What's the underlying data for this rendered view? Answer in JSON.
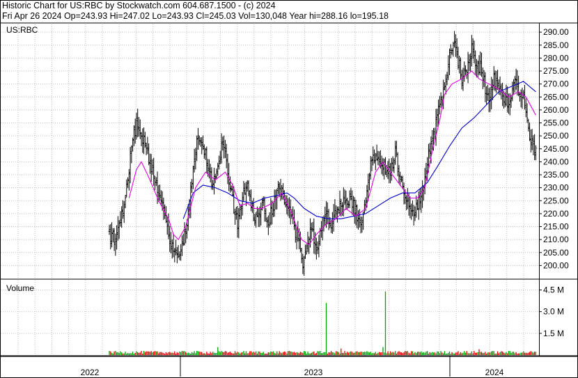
{
  "header": {
    "line1": "Historic Chart for US:RBC by Stockwatch.com 604.687.1500 - (c) 2024",
    "line2": "Fri Apr 26 2024   Op=243.93   Hi=247.02   Lo=243.93   Cl=245.03   Vol=130,048   Year hi=288.16   lo=195.18"
  },
  "chart_data": [
    {
      "type": "line",
      "panel": "price",
      "label": "US:RBC",
      "style": "OHLC bars with two moving averages",
      "ylim": [
        195,
        293
      ],
      "y_ticks": [
        "290.00",
        "285.00",
        "280.00",
        "275.00",
        "270.00",
        "265.00",
        "260.00",
        "255.00",
        "250.00",
        "245.00",
        "240.00",
        "235.00",
        "230.00",
        "225.00",
        "220.00",
        "215.00",
        "210.00",
        "205.00",
        "200.00"
      ],
      "x_ticks": [
        "2022",
        "2023",
        "2024"
      ],
      "grid": true,
      "colors": {
        "bars": "#000000",
        "ma_short": "#e000e0",
        "ma_long": "#0000cc"
      },
      "close_anchors": [
        {
          "i": 0,
          "c": 212
        },
        {
          "i": 5,
          "c": 210
        },
        {
          "i": 12,
          "c": 222
        },
        {
          "i": 18,
          "c": 245
        },
        {
          "i": 22,
          "c": 255
        },
        {
          "i": 28,
          "c": 248
        },
        {
          "i": 32,
          "c": 242
        },
        {
          "i": 38,
          "c": 232
        },
        {
          "i": 44,
          "c": 222
        },
        {
          "i": 48,
          "c": 210
        },
        {
          "i": 52,
          "c": 205
        },
        {
          "i": 58,
          "c": 206
        },
        {
          "i": 62,
          "c": 214
        },
        {
          "i": 66,
          "c": 228
        },
        {
          "i": 72,
          "c": 250
        },
        {
          "i": 76,
          "c": 247
        },
        {
          "i": 80,
          "c": 238
        },
        {
          "i": 84,
          "c": 232
        },
        {
          "i": 88,
          "c": 236
        },
        {
          "i": 92,
          "c": 248
        },
        {
          "i": 95,
          "c": 240
        },
        {
          "i": 100,
          "c": 225
        },
        {
          "i": 104,
          "c": 215
        },
        {
          "i": 108,
          "c": 225
        },
        {
          "i": 112,
          "c": 232
        },
        {
          "i": 116,
          "c": 222
        },
        {
          "i": 120,
          "c": 217
        },
        {
          "i": 124,
          "c": 225
        },
        {
          "i": 128,
          "c": 215
        },
        {
          "i": 132,
          "c": 222
        },
        {
          "i": 138,
          "c": 230
        },
        {
          "i": 142,
          "c": 226
        },
        {
          "i": 146,
          "c": 220
        },
        {
          "i": 150,
          "c": 215
        },
        {
          "i": 154,
          "c": 208
        },
        {
          "i": 157,
          "c": 200
        },
        {
          "i": 160,
          "c": 206
        },
        {
          "i": 164,
          "c": 214
        },
        {
          "i": 168,
          "c": 208
        },
        {
          "i": 172,
          "c": 212
        },
        {
          "i": 176,
          "c": 220
        },
        {
          "i": 180,
          "c": 215
        },
        {
          "i": 184,
          "c": 222
        },
        {
          "i": 188,
          "c": 224
        },
        {
          "i": 192,
          "c": 226
        },
        {
          "i": 196,
          "c": 225
        },
        {
          "i": 200,
          "c": 221
        },
        {
          "i": 204,
          "c": 216
        },
        {
          "i": 208,
          "c": 226
        },
        {
          "i": 212,
          "c": 238
        },
        {
          "i": 216,
          "c": 244
        },
        {
          "i": 220,
          "c": 240
        },
        {
          "i": 224,
          "c": 238
        },
        {
          "i": 228,
          "c": 236
        },
        {
          "i": 232,
          "c": 244
        },
        {
          "i": 236,
          "c": 233
        },
        {
          "i": 240,
          "c": 228
        },
        {
          "i": 244,
          "c": 224
        },
        {
          "i": 248,
          "c": 220
        },
        {
          "i": 252,
          "c": 226
        },
        {
          "i": 256,
          "c": 232
        },
        {
          "i": 260,
          "c": 245
        },
        {
          "i": 264,
          "c": 252
        },
        {
          "i": 268,
          "c": 262
        },
        {
          "i": 272,
          "c": 268
        },
        {
          "i": 276,
          "c": 280
        },
        {
          "i": 280,
          "c": 288
        },
        {
          "i": 283,
          "c": 279
        },
        {
          "i": 286,
          "c": 272
        },
        {
          "i": 290,
          "c": 276
        },
        {
          "i": 294,
          "c": 284
        },
        {
          "i": 298,
          "c": 278
        },
        {
          "i": 302,
          "c": 276
        },
        {
          "i": 305,
          "c": 268
        },
        {
          "i": 308,
          "c": 262
        },
        {
          "i": 312,
          "c": 272
        },
        {
          "i": 316,
          "c": 268
        },
        {
          "i": 320,
          "c": 264
        },
        {
          "i": 324,
          "c": 262
        },
        {
          "i": 328,
          "c": 270
        },
        {
          "i": 332,
          "c": 268
        },
        {
          "i": 336,
          "c": 264
        },
        {
          "i": 340,
          "c": 253
        },
        {
          "i": 344,
          "c": 246
        },
        {
          "i": 346,
          "c": 245
        }
      ],
      "ma_short_anchors": [
        {
          "i": 16,
          "v": 226
        },
        {
          "i": 22,
          "v": 237
        },
        {
          "i": 26,
          "v": 240
        },
        {
          "i": 32,
          "v": 234
        },
        {
          "i": 40,
          "v": 225
        },
        {
          "i": 48,
          "v": 218
        },
        {
          "i": 52,
          "v": 212
        },
        {
          "i": 56,
          "v": 210
        },
        {
          "i": 62,
          "v": 215
        },
        {
          "i": 70,
          "v": 230
        },
        {
          "i": 78,
          "v": 236
        },
        {
          "i": 86,
          "v": 233
        },
        {
          "i": 94,
          "v": 236
        },
        {
          "i": 100,
          "v": 231
        },
        {
          "i": 106,
          "v": 223
        },
        {
          "i": 112,
          "v": 224
        },
        {
          "i": 118,
          "v": 222
        },
        {
          "i": 124,
          "v": 222
        },
        {
          "i": 132,
          "v": 224
        },
        {
          "i": 140,
          "v": 228
        },
        {
          "i": 148,
          "v": 220
        },
        {
          "i": 156,
          "v": 210
        },
        {
          "i": 162,
          "v": 208
        },
        {
          "i": 168,
          "v": 212
        },
        {
          "i": 176,
          "v": 216
        },
        {
          "i": 184,
          "v": 218
        },
        {
          "i": 192,
          "v": 222
        },
        {
          "i": 200,
          "v": 219
        },
        {
          "i": 208,
          "v": 222
        },
        {
          "i": 216,
          "v": 236
        },
        {
          "i": 222,
          "v": 240
        },
        {
          "i": 228,
          "v": 236
        },
        {
          "i": 236,
          "v": 231
        },
        {
          "i": 244,
          "v": 226
        },
        {
          "i": 250,
          "v": 226
        },
        {
          "i": 256,
          "v": 230
        },
        {
          "i": 262,
          "v": 244
        },
        {
          "i": 268,
          "v": 256
        },
        {
          "i": 272,
          "v": 266
        },
        {
          "i": 278,
          "v": 270
        },
        {
          "i": 286,
          "v": 272
        },
        {
          "i": 294,
          "v": 275
        },
        {
          "i": 300,
          "v": 272
        },
        {
          "i": 308,
          "v": 270
        },
        {
          "i": 316,
          "v": 268
        },
        {
          "i": 324,
          "v": 265
        },
        {
          "i": 332,
          "v": 267
        },
        {
          "i": 338,
          "v": 265
        },
        {
          "i": 346,
          "v": 258
        }
      ],
      "ma_long_anchors": [
        {
          "i": 60,
          "v": 218
        },
        {
          "i": 68,
          "v": 228
        },
        {
          "i": 76,
          "v": 231
        },
        {
          "i": 86,
          "v": 230
        },
        {
          "i": 96,
          "v": 228
        },
        {
          "i": 106,
          "v": 225
        },
        {
          "i": 116,
          "v": 224
        },
        {
          "i": 126,
          "v": 226
        },
        {
          "i": 136,
          "v": 227
        },
        {
          "i": 144,
          "v": 228
        },
        {
          "i": 150,
          "v": 226
        },
        {
          "i": 158,
          "v": 222
        },
        {
          "i": 168,
          "v": 219
        },
        {
          "i": 178,
          "v": 218
        },
        {
          "i": 188,
          "v": 218
        },
        {
          "i": 198,
          "v": 219
        },
        {
          "i": 208,
          "v": 220
        },
        {
          "i": 218,
          "v": 223
        },
        {
          "i": 228,
          "v": 226
        },
        {
          "i": 238,
          "v": 228
        },
        {
          "i": 248,
          "v": 228
        },
        {
          "i": 258,
          "v": 232
        },
        {
          "i": 266,
          "v": 238
        },
        {
          "i": 276,
          "v": 246
        },
        {
          "i": 286,
          "v": 253
        },
        {
          "i": 296,
          "v": 257
        },
        {
          "i": 306,
          "v": 262
        },
        {
          "i": 316,
          "v": 267
        },
        {
          "i": 326,
          "v": 269
        },
        {
          "i": 336,
          "v": 271
        },
        {
          "i": 346,
          "v": 267
        }
      ]
    },
    {
      "type": "bar",
      "panel": "volume",
      "label": "Volume",
      "ylim_millions": [
        0,
        5.2
      ],
      "y_ticks": [
        "4.5 M",
        "3.0 M",
        "1.5 M"
      ],
      "colors": {
        "up": "#00a000",
        "down": "#e00000"
      },
      "baseline_millions": 0.22,
      "spikes": [
        {
          "i": 176,
          "v_millions": 3.6,
          "dir": "up"
        },
        {
          "i": 224,
          "v_millions": 4.4,
          "dir": "up"
        },
        {
          "i": 88,
          "v_millions": 0.55,
          "dir": "up"
        },
        {
          "i": 222,
          "v_millions": 0.55,
          "dir": "up"
        },
        {
          "i": 188,
          "v_millions": 0.45,
          "dir": "down"
        },
        {
          "i": 300,
          "v_millions": 0.4,
          "dir": "down"
        }
      ]
    }
  ]
}
